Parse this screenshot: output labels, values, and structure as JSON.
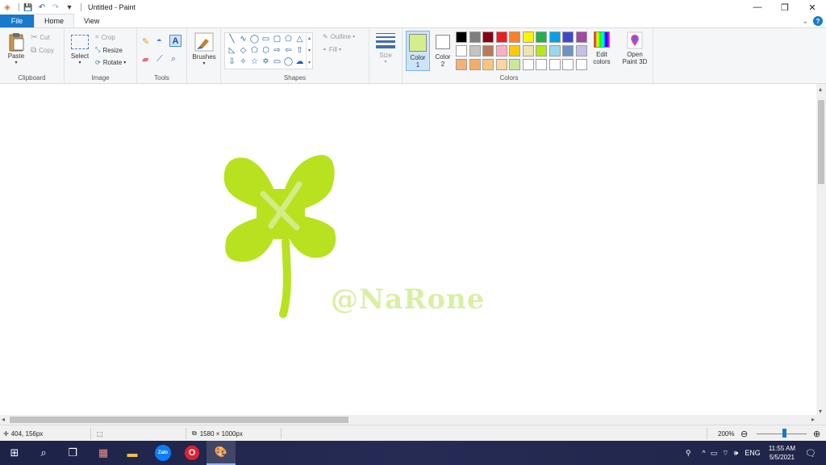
{
  "window": {
    "title": "Untitled - Paint",
    "controls": {
      "minimize": "—",
      "maximize": "❐",
      "close": "✕"
    }
  },
  "quick_access": {
    "save": "💾",
    "undo": "↶",
    "redo": "↷",
    "customize": "▾"
  },
  "tabs": [
    {
      "label": "File"
    },
    {
      "label": "Home"
    },
    {
      "label": "View"
    }
  ],
  "ribbon": {
    "clipboard": {
      "label": "Clipboard",
      "paste": "Paste",
      "cut": "Cut",
      "copy": "Copy"
    },
    "image": {
      "label": "Image",
      "select": "Select",
      "crop": "Crop",
      "resize": "Resize",
      "rotate": "Rotate"
    },
    "tools": {
      "label": "Tools"
    },
    "brushes": {
      "label": "Brushes"
    },
    "shapes": {
      "label": "Shapes",
      "outline": "Outline",
      "fill": "Fill"
    },
    "size": {
      "label": "Size"
    },
    "colors": {
      "label": "Colors",
      "color1": {
        "label_line1": "Color",
        "label_line2": "1",
        "value": "#d4ee8e"
      },
      "color2": {
        "label_line1": "Color",
        "label_line2": "2",
        "value": "#ffffff"
      },
      "edit_colors": {
        "line1": "Edit",
        "line2": "colors"
      },
      "palette_row1": [
        "#000000",
        "#7f7f7f",
        "#880015",
        "#ed1c24",
        "#ff7f27",
        "#fff200",
        "#22b14c",
        "#00a2e8",
        "#3f48cc",
        "#a349a4"
      ],
      "palette_row2": [
        "#ffffff",
        "#c3c3c3",
        "#b97a57",
        "#ffaec9",
        "#ffc90e",
        "#efe4b0",
        "#b5e61d",
        "#99d9ea",
        "#7092be",
        "#c8bfe7"
      ],
      "palette_row3": [
        "#f2b27a",
        "#f6ae66",
        "#f8c77e",
        "#fbd5a0",
        "#cbe89a",
        "#ffffff",
        "#ffffff",
        "#ffffff",
        "#ffffff",
        "#ffffff"
      ]
    },
    "paint3d": {
      "line1": "Open",
      "line2": "Paint 3D"
    }
  },
  "canvas": {
    "watermark": "@NaRone",
    "clover_color": "#b8e21f",
    "clover_mark_color": "#d2ec86",
    "watermark_color": "#d9efa4"
  },
  "status": {
    "cursor_pos": "404, 156px",
    "image_size": "1580 × 1000px",
    "zoom": "200%"
  },
  "taskbar": {
    "apps": [
      {
        "name": "start",
        "glyph": "⊞"
      },
      {
        "name": "search",
        "glyph": "⌕"
      },
      {
        "name": "task-view",
        "glyph": "❐"
      },
      {
        "name": "store",
        "glyph": "▦"
      },
      {
        "name": "file-explorer",
        "glyph": "▬"
      },
      {
        "name": "zalo",
        "glyph": "Zalo"
      },
      {
        "name": "opera",
        "glyph": "O"
      },
      {
        "name": "paint",
        "glyph": "🎨"
      }
    ],
    "tray": {
      "language": "ENG",
      "time": "11:55 AM",
      "date": "5/5/2021"
    }
  }
}
